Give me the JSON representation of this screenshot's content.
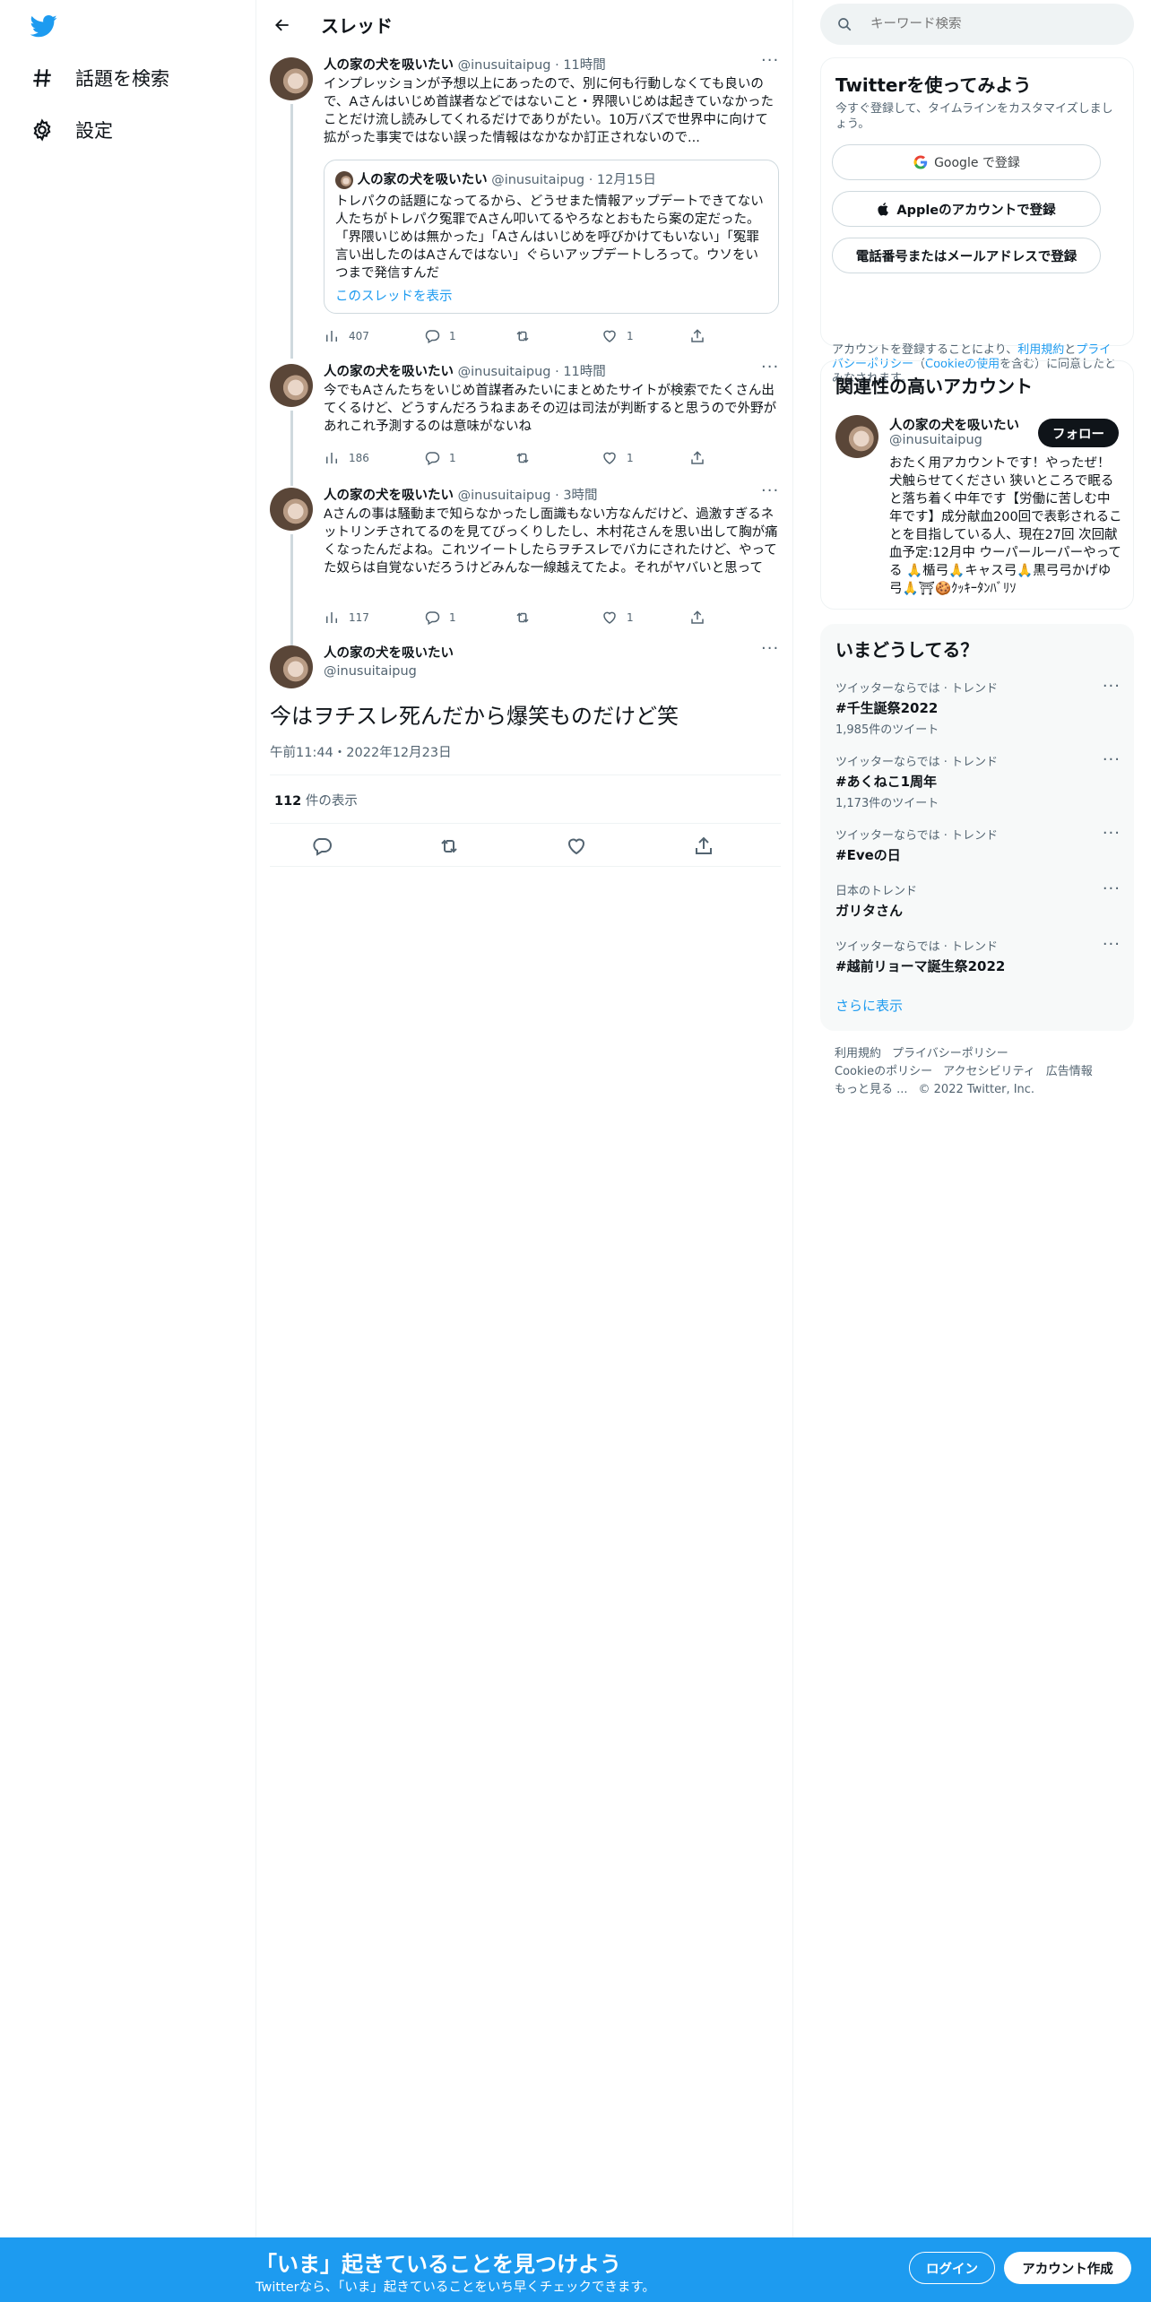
{
  "colors": {
    "accent": "#1d9bf0",
    "text": "#0f1419",
    "muted": "#536471",
    "banner_bg": "#1d9bf0"
  },
  "nav": {
    "logo_icon": "twitter-bird-icon",
    "items": [
      {
        "icon": "hashtag-icon",
        "label": "話題を検索"
      },
      {
        "icon": "gear-icon",
        "label": "設定"
      }
    ]
  },
  "header": {
    "title": "スレッド",
    "back_icon": "arrow-left-icon"
  },
  "tweets": [
    {
      "name": "人の家の犬を吸いたい",
      "handle": "@inusuitaipug",
      "time": "· 11時間",
      "text": "インプレッションが予想以上にあったので、別に何も行動しなくても良いので、Aさんはいじめ首謀者などではないこと・界隈いじめは起きていなかったことだけ流し読みしてくれるだけでありがたい。10万バズで世界中に向けて拡がった事実ではない誤った情報はなかなか訂正されないので...",
      "quote": {
        "name": "人の家の犬を吸いたい",
        "handle": "@inusuitaipug",
        "time": "· 12月15日",
        "text": "トレパクの話題になってるから、どうせまた情報アップデートできてない人たちがトレパク冤罪でAさん叩いてるやろなとおもたら案の定だった。「界隈いじめは無かった」「Aさんはいじめを呼びかけてもいない」「冤罪言い出したのはAさんではない」ぐらいアップデートしろって。ウソをいつまで発信すんだ",
        "link": "このスレッドを表示"
      },
      "views": "407",
      "replies": "1",
      "retweets": "",
      "likes": "1"
    },
    {
      "name": "人の家の犬を吸いたい",
      "handle": "@inusuitaipug",
      "time": "· 11時間",
      "text": "今でもAさんたちをいじめ首謀者みたいにまとめたサイトが検索でたくさん出てくるけど、どうすんだろうねまあその辺は司法が判断すると思うので外野があれこれ予測するのは意味がないね",
      "views": "186",
      "replies": "1",
      "retweets": "",
      "likes": "1"
    },
    {
      "name": "人の家の犬を吸いたい",
      "handle": "@inusuitaipug",
      "time": "· 3時間",
      "text": "Aさんの事は騒動まで知らなかったし面識もない方なんだけど、過激すぎるネットリンチされてるのを見てびっくりしたし、木村花さんを思い出して胸が痛くなったんだよね。これツイートしたらヲチスレでバカにされたけど、やってた奴らは自覚ないだろうけどみんな一線越えてたよ。それがヤバいと思って",
      "views": "117",
      "replies": "1",
      "retweets": "",
      "likes": "1"
    }
  ],
  "focus_tweet": {
    "name": "人の家の犬を吸いたい",
    "handle": "@inusuitaipug",
    "text": "今はヲチスレ死んだから爆笑ものだけど笑",
    "meta": "午前11:44・2022年12月23日",
    "views_count": "112",
    "views_label": " 件の表示"
  },
  "search": {
    "placeholder": "キーワード検索"
  },
  "signup_card": {
    "title": "Twitterを使ってみよう",
    "subtitle": "今すぐ登録して、タイムラインをカスタマイズしましょう。",
    "google": "Google で登録",
    "apple": "Appleのアカウントで登録",
    "phone": "電話番号またはメールアドレスで登録",
    "terms_prefix": "アカウントを登録することにより、",
    "terms_link1": "利用規約",
    "terms_and": "と",
    "terms_link2": "プライバシーポリシー",
    "terms_open": "（",
    "terms_link3": "Cookieの使用",
    "terms_suffix": "を含む）に同意したとみなされます。"
  },
  "related": {
    "title": "関連性の高いアカウント",
    "name": "人の家の犬を吸いたい",
    "handle": "@inusuitaipug",
    "follow": "フォロー",
    "bio": "おたく用アカウントです！やったぜ！犬触らせてください 狭いところで眠ると落ち着く中年です【労働に苦しむ中年です】成分献血200回で表彰されることを目指している人、現在27回 次回献血予定:12月中 ウーパールーパーやってる 🙏楯弓🙏キャス弓🙏黒弓弓かげゆ弓🙏⛩🍪ｸｯｷｰﾀﾝﾊﾞﾘｿ"
  },
  "trends": {
    "title": "いまどうしてる？",
    "items": [
      {
        "context": "ツイッターならでは · トレンド",
        "name": "#千生誕祭2022",
        "count": "1,985件のツイート"
      },
      {
        "context": "ツイッターならでは · トレンド",
        "name": "#あくねこ1周年",
        "count": "1,173件のツイート"
      },
      {
        "context": "ツイッターならでは · トレンド",
        "name": "#Eveの日",
        "count": ""
      },
      {
        "context": "日本のトレンド",
        "name": "ガリタさん",
        "count": ""
      },
      {
        "context": "ツイッターならでは · トレンド",
        "name": "#越前リョーマ誕生祭2022",
        "count": ""
      }
    ],
    "show_more": "さらに表示"
  },
  "footer": {
    "links": [
      "利用規約",
      "プライバシーポリシー",
      "Cookieのポリシー",
      "アクセシビリティ",
      "広告情報",
      "もっと見る ..."
    ],
    "copyright": "© 2022 Twitter, Inc."
  },
  "banner": {
    "title": "「いま」起きていることを見つけよう",
    "subtitle": "Twitterなら、「いま」起きていることをいち早くチェックできます。",
    "login": "ログイン",
    "signup": "アカウント作成"
  }
}
